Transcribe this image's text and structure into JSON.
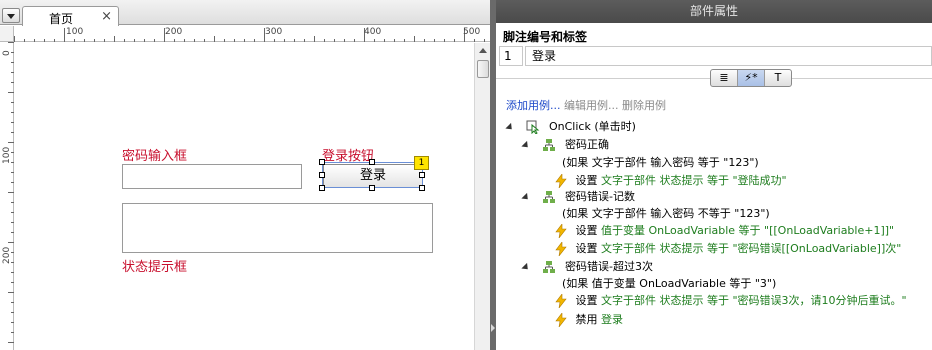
{
  "tabs": {
    "home_label": "首页",
    "close_glyph": "×"
  },
  "ruler": {
    "h_labels": [
      "100",
      "200",
      "300",
      "400",
      "500"
    ],
    "v_labels": [
      "0",
      "100",
      "200"
    ]
  },
  "canvas": {
    "password_label": "密码输入框",
    "login_label": "登录按钮",
    "login_button_text": "登录",
    "footnote_badge": "1",
    "status_label": "状态提示框"
  },
  "panel": {
    "title": "部件属性",
    "footnote_section_title": "脚注编号和标签",
    "footnote_number": "1",
    "footnote_label": "登录",
    "tabs": [
      {
        "icon": "notes-icon",
        "glyph": "≣",
        "active": false
      },
      {
        "icon": "interaction-icon",
        "glyph": "⚡*",
        "active": true
      },
      {
        "icon": "style-icon",
        "glyph": "T",
        "active": false
      }
    ],
    "actions": {
      "add": "添加用例...",
      "edit": "编辑用例...",
      "delete": "删除用例"
    },
    "event": {
      "name": "OnClick (单击时)",
      "cases": [
        {
          "name": "密码正确",
          "condition": "(如果 文字于部件 输入密码 等于 \"123\")",
          "actions": [
            {
              "verb": "设置",
              "target": "文字于部件 状态提示 等于 \"登陆成功\""
            }
          ]
        },
        {
          "name": "密码错误-记数",
          "condition": "(如果 文字于部件 输入密码 不等于 \"123\")",
          "actions": [
            {
              "verb": "设置",
              "target": "值于变量 OnLoadVariable 等于 \"[[OnLoadVariable+1]]\""
            },
            {
              "verb": "设置",
              "target": "文字于部件 状态提示 等于 \"密码错误[[OnLoadVariable]]次\""
            }
          ]
        },
        {
          "name": "密码错误-超过3次",
          "condition": "(如果 值于变量 OnLoadVariable 等于 \"3\")",
          "actions": [
            {
              "verb": "设置",
              "target": "文字于部件 状态提示 等于 \"密码错误3次，请10分钟后重试。\""
            },
            {
              "verb": "禁用",
              "target": "登录"
            }
          ]
        }
      ]
    }
  },
  "colors": {
    "annotation_red": "#c8102e",
    "action_green": "#1e7d1e",
    "link_blue": "#1a46c8",
    "panel_header": "#4a4a4a",
    "footnote_yellow": "#ffe400"
  }
}
